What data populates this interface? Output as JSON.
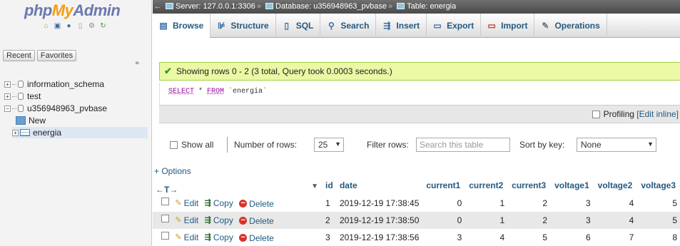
{
  "logo": {
    "part1": "php",
    "part2": "My",
    "part3": "Admin"
  },
  "nav_icons": [
    "home-icon",
    "exit-icon",
    "help-icon",
    "docs-icon",
    "settings-icon",
    "reload-icon"
  ],
  "left_tabs": {
    "recent": "Recent",
    "favorites": "Favorites"
  },
  "tree": [
    {
      "label": "information_schema",
      "expander": "+"
    },
    {
      "label": "test",
      "expander": "+"
    },
    {
      "label": "u356948963_pvbase",
      "expander": "−"
    },
    {
      "label": "New"
    },
    {
      "label": "energia",
      "expander": "+"
    }
  ],
  "breadcrumb": {
    "server": "Server: 127.0.0.1:3306",
    "database": "Database: u356948963_pvbase",
    "table": "Table: energia"
  },
  "menu": [
    {
      "label": "Browse",
      "icon": "browse-icon"
    },
    {
      "label": "Structure",
      "icon": "structure-icon"
    },
    {
      "label": "SQL",
      "icon": "sql-icon"
    },
    {
      "label": "Search",
      "icon": "search-icon"
    },
    {
      "label": "Insert",
      "icon": "insert-icon"
    },
    {
      "label": "Export",
      "icon": "export-icon"
    },
    {
      "label": "Import",
      "icon": "import-icon"
    },
    {
      "label": "Operations",
      "icon": "operations-icon"
    }
  ],
  "success_message": "Showing rows 0 - 2 (3 total, Query took 0.0003 seconds.)",
  "sql": {
    "keyword1": "SELECT",
    "middle": " * ",
    "keyword2": "FROM",
    "table": " `energia`"
  },
  "profiling": {
    "label": "Profiling",
    "edit_inline": "[Edit inline]"
  },
  "nav_controls": {
    "show_all": "Show all",
    "rows_label": "Number of rows:",
    "rows_value": "25",
    "filter_label": "Filter rows:",
    "filter_placeholder": "Search this table",
    "sort_label": "Sort by key:",
    "sort_value": "None"
  },
  "options_link": "+ Options",
  "col_arrows": "←T→",
  "columns": [
    "id",
    "date",
    "current1",
    "current2",
    "current3",
    "voltage1",
    "voltage2",
    "voltage3"
  ],
  "row_actions": {
    "edit": "Edit",
    "copy": "Copy",
    "delete": "Delete"
  },
  "rows": [
    [
      "1",
      "2019-12-19 17:38:45",
      "0",
      "1",
      "2",
      "3",
      "4",
      "5"
    ],
    [
      "2",
      "2019-12-19 17:38:50",
      "0",
      "1",
      "2",
      "3",
      "4",
      "5"
    ],
    [
      "3",
      "2019-12-19 17:38:56",
      "3",
      "4",
      "5",
      "6",
      "7",
      "8"
    ]
  ],
  "colors": {
    "link": "#235a81",
    "success_bg": "#ebf8a4",
    "logo_blue": "#6c78af",
    "logo_orange": "#f89c0e"
  }
}
